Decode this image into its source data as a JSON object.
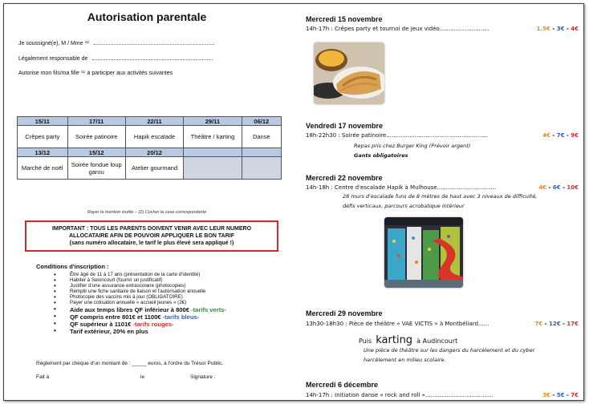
{
  "left": {
    "title": "Autorisation parentale",
    "lines": [
      "Je soussigné(e), M / Mme ⁽¹⁾",
      "Légalement responsable de",
      "Autorise mon fils/ma fille ⁽¹⁾ à participer aux activités suivantes"
    ],
    "table": {
      "row1_dates": [
        "15/11",
        "17/11",
        "22/11",
        "29/11",
        "06/12"
      ],
      "row1_acts": [
        "Crêpes party",
        "Soirée patinoire",
        "Hapik escalade",
        "Théâtre / karting",
        "Danse"
      ],
      "row2_dates": [
        "13/12",
        "15/12",
        "20/12",
        "",
        ""
      ],
      "row2_acts": [
        "Marché de noël",
        "Soirée fondue loup garou",
        "Atelier gourmand",
        "",
        ""
      ]
    },
    "note": "Rayer la mention inutile – (2) Cocher la case correspondante",
    "important": [
      "IMPORTANT : TOUS LES PARENTS DOIVENT VENIR AVEC LEUR NUMERO",
      "ALLOCATAIRE AFIN DE POUVOIR APPLIQUER LE BON TARIF",
      "(sans numéro allocataire, le tarif le plus élevé sera appliqué !)"
    ],
    "conditions_title": "Conditions d'inscription :",
    "conditions": [
      "Être âgé de 11 à 17 ans (présentation de la carte d'identité)",
      "Habiter à Seloncourt (fournir un justificatif)",
      "Justifier d'une assurance extrascolaire (photocopies)",
      "Remplir une fiche sanitaire de liaison et l'autorisation annuelle",
      "Photocopie des vaccins mis à jour (OBLIGATOIRE)",
      "Payer une cotisation annuelle « accueil jeunes » (2€)"
    ],
    "tarifs": [
      {
        "text": "Aide aux temps libres QF inférieur à 800€",
        "suffix": " -tarifs verts-"
      },
      {
        "text": "QF compris entre 801€ et 1100€",
        "suffix": " -tarifs bleus-"
      },
      {
        "text": "QF supérieur à 1101€",
        "suffix": " -tarifs rouges-"
      },
      {
        "text": "Tarif extérieur, 20% en plus",
        "suffix": ""
      }
    ],
    "reglement": "Règlement par chèque d'un montant de : _____ euros, à l'ordre du Trésor Public.",
    "fait": "Fait à",
    "le": "le",
    "signature": "Signature :"
  },
  "right": {
    "events": [
      {
        "date": "Mercredi 15 novembre",
        "line": "14h-17h : Crêpes party et tournoi de jeux vidéo............................",
        "prices": [
          "1.5€",
          "3€",
          "4€"
        ]
      },
      {
        "date": "Vendredi 17 novembre",
        "line": "18h-22h30 : Soirée patinoire.........................................................",
        "prices": [
          "4€",
          "7€",
          "9€"
        ],
        "notes": [
          "Repas pris chez Burger King (Prévoir argent)",
          "Gants obligatoires"
        ]
      },
      {
        "date": "Mercredi 22 novembre",
        "line": "14h-18h : Centre d'escalade Hapik à Mulhouse.................................",
        "prices": [
          "4€",
          "6€",
          "10€"
        ],
        "notes": [
          "28 murs d'escalade funs de 8 mètres de haut avec 3 niveaux de difficulté,",
          "défis verticaux, parcours acrobatique intérieur"
        ]
      },
      {
        "date": "Mercredi 29 novembre",
        "line": "13h30-18h30 : Pièce de théâtre « VAE VICTIS » à Montbéliard......",
        "prices": [
          "7€",
          "12€",
          "17€"
        ],
        "puis": "Puis",
        "karting": "karting",
        "karting_place": "à Audincourt",
        "notes": [
          "Une pièce de théâtre sur les dangers du harcèlement et du cyber",
          "harcèlement en milieu scolaire."
        ]
      },
      {
        "date": "Mercredi 6 décembre",
        "line": "14h-17h : Initiation danse « rock and roll »......................................",
        "prices": [
          "3€",
          "5€",
          "7€"
        ]
      }
    ]
  }
}
